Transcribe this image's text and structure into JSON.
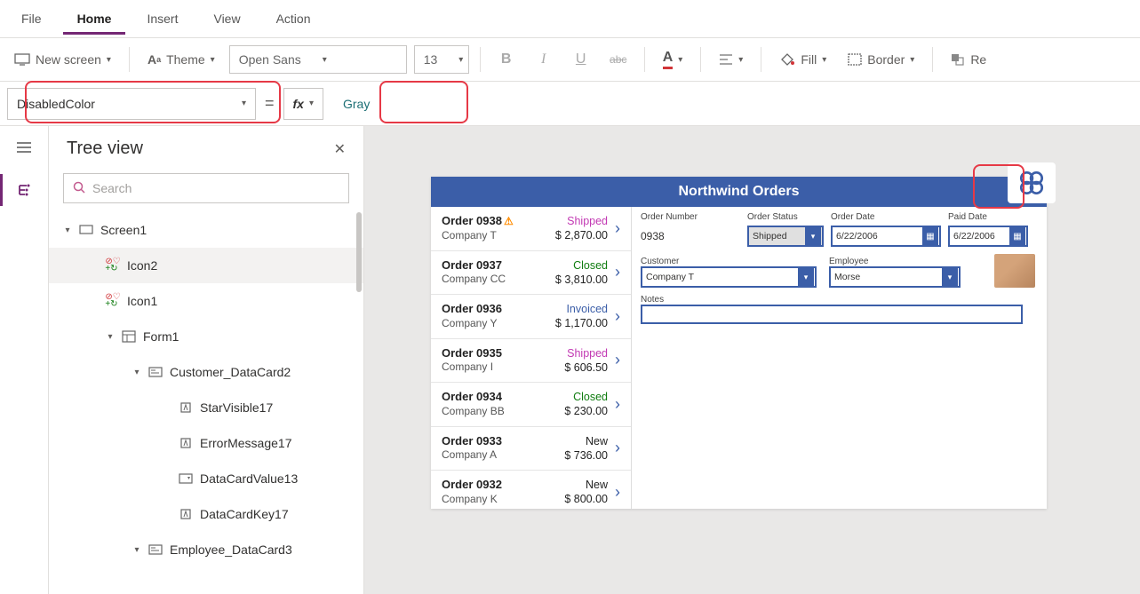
{
  "menu": {
    "file": "File",
    "home": "Home",
    "insert": "Insert",
    "view": "View",
    "action": "Action"
  },
  "ribbon": {
    "new_screen": "New screen",
    "theme": "Theme",
    "font": "Open Sans",
    "font_size": "13",
    "fill": "Fill",
    "border": "Border",
    "reorder": "Re"
  },
  "formula": {
    "property": "DisabledColor",
    "fx": "fx",
    "value": "Gray"
  },
  "tree": {
    "title": "Tree view",
    "search_placeholder": "Search",
    "items": [
      {
        "label": "Screen1",
        "indent": 0,
        "expander": "▾",
        "icon": "screen"
      },
      {
        "label": "Icon2",
        "indent": 1,
        "icon": "icon-double",
        "selected": true
      },
      {
        "label": "Icon1",
        "indent": 1,
        "icon": "icon-double"
      },
      {
        "label": "Form1",
        "indent": 2,
        "expander": "▾",
        "icon": "form"
      },
      {
        "label": "Customer_DataCard2",
        "indent": 3,
        "expander": "▾",
        "icon": "datacard"
      },
      {
        "label": "StarVisible17",
        "indent": 4,
        "icon": "label"
      },
      {
        "label": "ErrorMessage17",
        "indent": 4,
        "icon": "label"
      },
      {
        "label": "DataCardValue13",
        "indent": 4,
        "icon": "combo"
      },
      {
        "label": "DataCardKey17",
        "indent": 4,
        "icon": "label"
      },
      {
        "label": "Employee_DataCard3",
        "indent": 3,
        "expander": "▾",
        "icon": "datacard"
      }
    ]
  },
  "app": {
    "title": "Northwind Orders",
    "orders": [
      {
        "num": "Order 0938",
        "cust": "Company T",
        "status": "Shipped",
        "amount": "$ 2,870.00",
        "warn": true
      },
      {
        "num": "Order 0937",
        "cust": "Company CC",
        "status": "Closed",
        "amount": "$ 3,810.00"
      },
      {
        "num": "Order 0936",
        "cust": "Company Y",
        "status": "Invoiced",
        "amount": "$ 1,170.00"
      },
      {
        "num": "Order 0935",
        "cust": "Company I",
        "status": "Shipped",
        "amount": "$ 606.50"
      },
      {
        "num": "Order 0934",
        "cust": "Company BB",
        "status": "Closed",
        "amount": "$ 230.00"
      },
      {
        "num": "Order 0933",
        "cust": "Company A",
        "status": "New",
        "amount": "$ 736.00"
      },
      {
        "num": "Order 0932",
        "cust": "Company K",
        "status": "New",
        "amount": "$ 800.00"
      }
    ],
    "detail": {
      "labels": {
        "order_number": "Order Number",
        "order_status": "Order Status",
        "order_date": "Order Date",
        "paid_date": "Paid Date",
        "customer": "Customer",
        "employee": "Employee",
        "notes": "Notes"
      },
      "order_number": "0938",
      "order_status": "Shipped",
      "order_date": "6/22/2006",
      "paid_date": "6/22/2006",
      "customer": "Company T",
      "employee": "Morse"
    }
  }
}
